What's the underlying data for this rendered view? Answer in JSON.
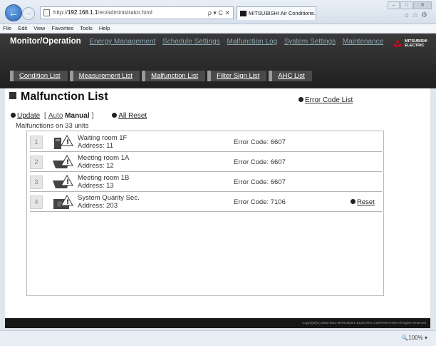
{
  "browser": {
    "url_prefix": "http://",
    "url_host": "192.168.1.1",
    "url_path": "/en/administrator.html",
    "address_tools": "ρ ▾ C ✕",
    "tab_title": "MITSUBISHI Air Conditione...",
    "tab_close": "×",
    "menu": [
      "File",
      "Edit",
      "View",
      "Favorites",
      "Tools",
      "Help"
    ],
    "zoom": "100%"
  },
  "app": {
    "main_nav": {
      "active": "Monitor/Operation",
      "links": [
        "Energy Management",
        "Schedule Settings",
        "Malfunction Log",
        "System Settings",
        "Maintenance"
      ]
    },
    "logo_text": [
      "MITSUBISHI",
      "ELECTRIC"
    ],
    "sub_nav": [
      "Condition List",
      "Measurement List",
      "Malfunction List",
      "Filter Sign List",
      "AHC List"
    ]
  },
  "page": {
    "title": "Malfunction List",
    "error_code_link": "Error Code List",
    "update": "Update",
    "bracket_open": "[",
    "auto": "Auto",
    "manual": "Manual",
    "bracket_close": "]",
    "all_reset": "All Reset",
    "units_text": "Malfunctions on 33 units"
  },
  "malfunctions": [
    {
      "num": "1",
      "name": "Waiting room 1F",
      "address": "Address: 11",
      "error": "Error Code: 6607",
      "reset": ""
    },
    {
      "num": "2",
      "name": "Meeting room 1A",
      "address": "Address: 12",
      "error": "Error Code: 6607",
      "reset": ""
    },
    {
      "num": "3",
      "name": "Meeting room 1B",
      "address": "Address: 13",
      "error": "Error Code: 6607",
      "reset": ""
    },
    {
      "num": "4",
      "name": "System Quarity Sec.",
      "address": "Address: 203",
      "error": "Error Code: 7106",
      "reset": "Reset"
    }
  ],
  "footer": "Copyright(C) 2002-2013 MITSUBISHI ELECTRIC CORPORATION All Rights Reserved",
  "colors": {
    "header_bg": "#202020",
    "link_muted": "#8aa6b0",
    "sub_nav_bg": "#4a4a4a"
  }
}
